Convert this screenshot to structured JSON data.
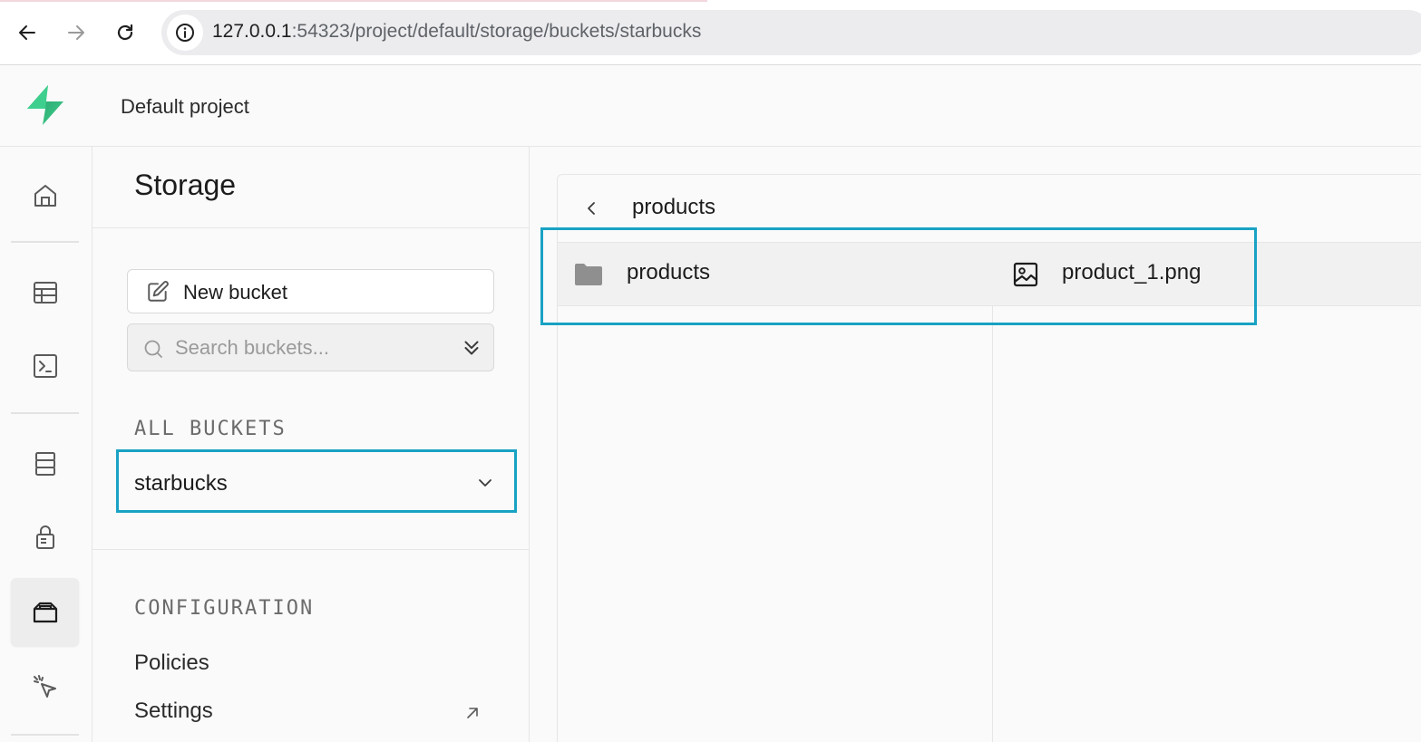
{
  "browser": {
    "url_host": "127.0.0.1",
    "url_rest": ":54323/project/default/storage/buckets/starbucks"
  },
  "header": {
    "project_name": "Default project"
  },
  "rail": {
    "items": [
      "home-icon",
      "table-editor-icon",
      "sql-editor-icon",
      "database-icon",
      "auth-icon",
      "storage-icon",
      "advisors-icon"
    ],
    "active": "storage-icon"
  },
  "storage_menu": {
    "title": "Storage",
    "new_bucket_label": "New bucket",
    "search_placeholder": "Search buckets...",
    "all_buckets_label": "ALL BUCKETS",
    "buckets": [
      {
        "name": "starbucks",
        "selected": true
      }
    ],
    "configuration_label": "CONFIGURATION",
    "config_links": [
      {
        "label": "Policies"
      },
      {
        "label": "Settings"
      }
    ]
  },
  "explorer": {
    "path_title": "products",
    "columns": [
      {
        "items": [
          {
            "type": "folder",
            "name": "products"
          }
        ]
      },
      {
        "items": [
          {
            "type": "image",
            "name": "product_1.png"
          }
        ]
      }
    ]
  },
  "colors": {
    "accent": "#3ecf8e",
    "highlight": "#19a2c4"
  }
}
